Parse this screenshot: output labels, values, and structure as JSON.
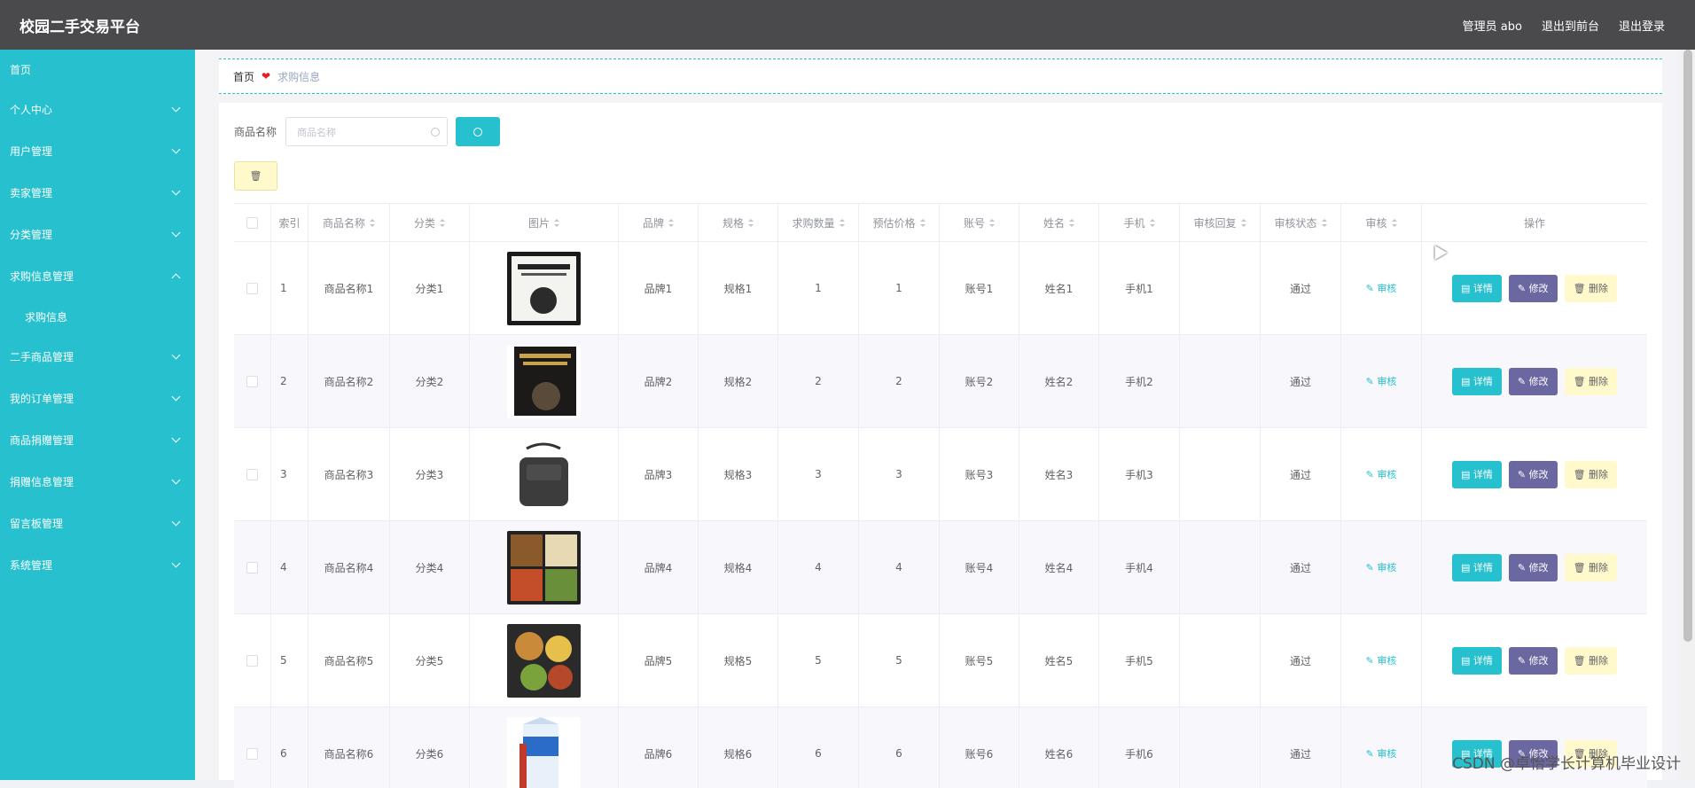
{
  "header": {
    "title": "校园二手交易平台",
    "admin": "管理员 abo",
    "to_front": "退出到前台",
    "logout": "退出登录"
  },
  "sidebar": {
    "items": [
      {
        "label": "首页",
        "expandable": false
      },
      {
        "label": "个人中心",
        "expandable": true
      },
      {
        "label": "用户管理",
        "expandable": true
      },
      {
        "label": "卖家管理",
        "expandable": true
      },
      {
        "label": "分类管理",
        "expandable": true
      },
      {
        "label": "求购信息管理",
        "expandable": true,
        "expanded": true,
        "children": [
          "求购信息"
        ]
      },
      {
        "label": "二手商品管理",
        "expandable": true
      },
      {
        "label": "我的订单管理",
        "expandable": true
      },
      {
        "label": "商品捐赠管理",
        "expandable": true
      },
      {
        "label": "捐赠信息管理",
        "expandable": true
      },
      {
        "label": "留言板管理",
        "expandable": true
      },
      {
        "label": "系统管理",
        "expandable": true
      }
    ]
  },
  "breadcrumb": {
    "home": "首页",
    "separator": "❤",
    "current": "求购信息"
  },
  "search": {
    "label": "商品名称",
    "placeholder": "商品名称"
  },
  "table": {
    "headers": [
      "索引",
      "商品名称",
      "分类",
      "图片",
      "品牌",
      "规格",
      "求购数量",
      "预估价格",
      "账号",
      "姓名",
      "手机",
      "审核回复",
      "审核状态",
      "审核",
      "操作"
    ],
    "rows": [
      {
        "index": "1",
        "name": "商品名称1",
        "category": "分类1",
        "image": "book-cover-white",
        "brand": "品牌1",
        "spec": "规格1",
        "qty": "1",
        "price": "1",
        "account": "账号1",
        "uname": "姓名1",
        "phone": "手机1",
        "reply": "",
        "status": "通过"
      },
      {
        "index": "2",
        "name": "商品名称2",
        "category": "分类2",
        "image": "book-cover-dark",
        "brand": "品牌2",
        "spec": "规格2",
        "qty": "2",
        "price": "2",
        "account": "账号2",
        "uname": "姓名2",
        "phone": "手机2",
        "reply": "",
        "status": "通过"
      },
      {
        "index": "3",
        "name": "商品名称3",
        "category": "分类3",
        "image": "shoulder-bag",
        "brand": "品牌3",
        "spec": "规格3",
        "qty": "3",
        "price": "3",
        "account": "账号3",
        "uname": "姓名3",
        "phone": "手机3",
        "reply": "",
        "status": "通过"
      },
      {
        "index": "4",
        "name": "商品名称4",
        "category": "分类4",
        "image": "bento-box",
        "brand": "品牌4",
        "spec": "规格4",
        "qty": "4",
        "price": "4",
        "account": "账号4",
        "uname": "姓名4",
        "phone": "手机4",
        "reply": "",
        "status": "通过"
      },
      {
        "index": "5",
        "name": "商品名称5",
        "category": "分类5",
        "image": "food-box",
        "brand": "品牌5",
        "spec": "规格5",
        "qty": "5",
        "price": "5",
        "account": "账号5",
        "uname": "姓名5",
        "phone": "手机5",
        "reply": "",
        "status": "通过"
      },
      {
        "index": "6",
        "name": "商品名称6",
        "category": "分类6",
        "image": "milk-carton",
        "brand": "品牌6",
        "spec": "规格6",
        "qty": "6",
        "price": "6",
        "account": "账号6",
        "uname": "姓名6",
        "phone": "手机6",
        "reply": "",
        "status": "通过"
      }
    ],
    "audit_label": "审核",
    "actions": {
      "detail": "详情",
      "edit": "修改",
      "delete": "删除"
    }
  },
  "watermark": "CSDN @卓怡学长计算机毕业设计",
  "colors": {
    "accent": "#26c0ce",
    "topbar": "#4a4a4c",
    "edit": "#6b67a0",
    "delete": "#fff9cc"
  }
}
